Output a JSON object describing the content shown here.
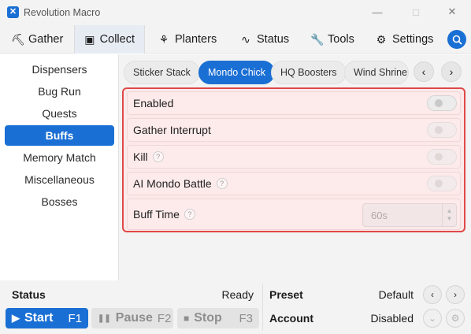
{
  "window": {
    "title": "Revolution Macro",
    "app_icon": "hexagon-x-icon",
    "controls": {
      "minimize": "—",
      "maximize": "□",
      "close": "✕"
    }
  },
  "main_tabs": [
    {
      "label": "Gather",
      "icon": "pickaxe-icon",
      "glyph": "⛏"
    },
    {
      "label": "Collect",
      "icon": "collect-icon",
      "glyph": "▣"
    },
    {
      "label": "Planters",
      "icon": "planter-icon",
      "glyph": "⚘"
    },
    {
      "label": "Status",
      "icon": "pulse-icon",
      "glyph": "∿"
    },
    {
      "label": "Tools",
      "icon": "wrench-icon",
      "glyph": "🔧"
    },
    {
      "label": "Settings",
      "icon": "gear-icon",
      "glyph": "⚙"
    }
  ],
  "active_main_tab": "Collect",
  "search_icon": "search-icon",
  "sidebar": {
    "items": [
      "Dispensers",
      "Bug Run",
      "Quests",
      "Buffs",
      "Memory Match",
      "Miscellaneous",
      "Bosses"
    ],
    "active": "Buffs"
  },
  "subtabs": {
    "items": [
      "Sticker Stack",
      "Mondo Chick",
      "HQ Boosters",
      "Wind Shrine"
    ],
    "active": "Mondo Chick",
    "prev_glyph": "‹",
    "next_glyph": "›"
  },
  "settings": {
    "enabled": {
      "label": "Enabled",
      "value": false
    },
    "gather_interrupt": {
      "label": "Gather Interrupt",
      "value": false
    },
    "kill": {
      "label": "Kill",
      "help": "?",
      "value": false
    },
    "ai_mondo_battle": {
      "label": "AI Mondo Battle",
      "help": "?",
      "value": false
    },
    "buff_time": {
      "label": "Buff Time",
      "help": "?",
      "value": "60s"
    }
  },
  "bottom": {
    "status_label": "Status",
    "status_value": "Ready",
    "preset_label": "Preset",
    "preset_value": "Default",
    "account_label": "Account",
    "account_value": "Disabled",
    "start": {
      "label": "Start",
      "key": "F1",
      "glyph": "▶"
    },
    "pause": {
      "label": "Pause",
      "key": "F2",
      "glyph": "❚❚"
    },
    "stop": {
      "label": "Stop",
      "key": "F3",
      "glyph": "■"
    },
    "preset_prev": "‹",
    "preset_next": "›",
    "account_dropdown": "⌄",
    "account_settings": "⚙"
  },
  "colors": {
    "accent": "#1a6fd4",
    "highlight_border": "#e04848",
    "highlight_bg": "#fbe9e9",
    "chrome_bg": "#f3f3f3"
  }
}
